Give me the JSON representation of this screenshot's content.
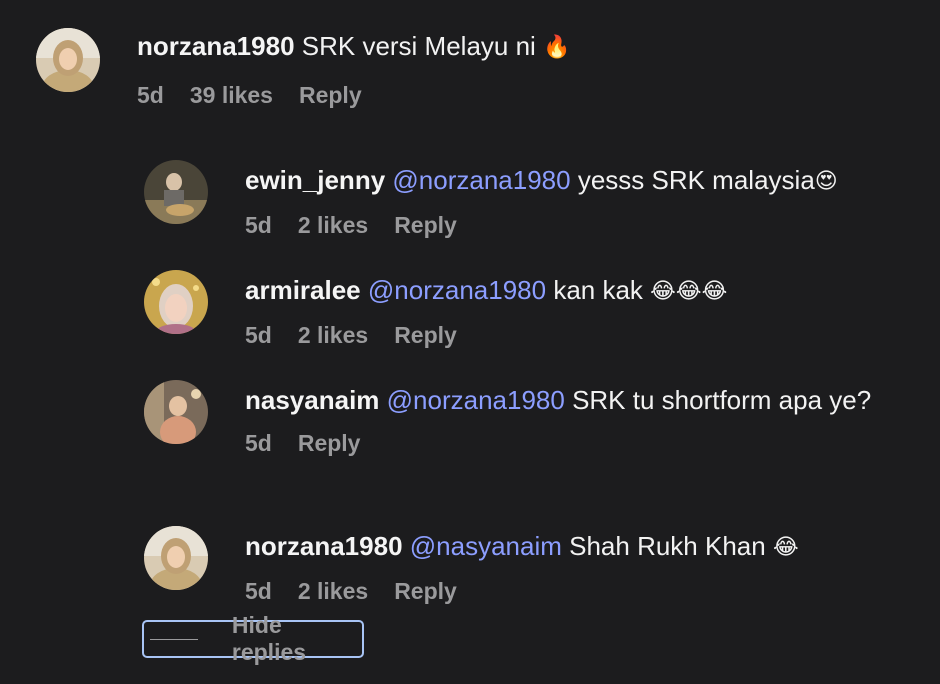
{
  "comments": [
    {
      "username": "norzana1980",
      "mention": "",
      "text": " SRK versi Melayu ni ",
      "emoji": "🔥",
      "time": "5d",
      "likes": "39 likes",
      "reply": "Reply"
    },
    {
      "username": "ewin_jenny",
      "mention": "@norzana1980",
      "text": " yesss SRK malaysia",
      "emoji": "😍",
      "time": "5d",
      "likes": "2 likes",
      "reply": "Reply"
    },
    {
      "username": "armiralee",
      "mention": "@norzana1980",
      "text": " kan kak ",
      "emoji": "😂😂😂",
      "time": "5d",
      "likes": "2 likes",
      "reply": "Reply"
    },
    {
      "username": "nasyanaim",
      "mention": "@norzana1980",
      "text": " SRK tu shortform apa ye?",
      "emoji": "",
      "time": "5d",
      "likes": "",
      "reply": "Reply"
    },
    {
      "username": "norzana1980",
      "mention": "@nasyanaim",
      "text": " Shah Rukh Khan ",
      "emoji": "😂",
      "time": "5d",
      "likes": "2 likes",
      "reply": "Reply"
    }
  ],
  "hide_replies_label": "Hide replies",
  "colors": {
    "background": "#1c1c1e",
    "mention": "#8c9eff",
    "meta": "#9a9a9c",
    "focus_ring": "#a8c4f5"
  }
}
